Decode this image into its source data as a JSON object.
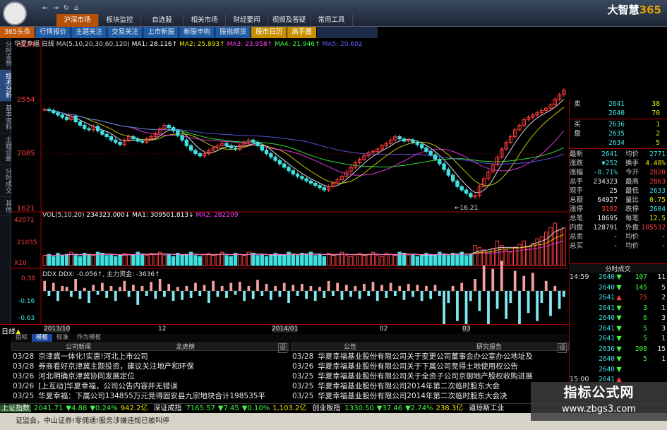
{
  "app": {
    "brand_name": "大智慧",
    "brand_num": "365",
    "top_nav": [
      "←",
      "→",
      "↻",
      "⌂"
    ],
    "menu": [
      "沪深市场",
      "板块监控",
      "自选股",
      "相关市场",
      "财经要闻",
      "视频及答疑",
      "常用工具"
    ],
    "menu_active_index": 0
  },
  "nav2": [
    {
      "label": "365头条",
      "style": "orange"
    },
    {
      "label": "行情报价",
      "style": "blue"
    },
    {
      "label": "主题关注",
      "style": "blue"
    },
    {
      "label": "交易关注",
      "style": "blue"
    },
    {
      "label": "上市新股",
      "style": "blue"
    },
    {
      "label": "新股申购",
      "style": "blue"
    },
    {
      "label": "股指期货",
      "style": "blue"
    },
    {
      "label": "股市日历",
      "style": "gold"
    },
    {
      "label": "高手圈",
      "style": "gold"
    }
  ],
  "left_tabs": [
    {
      "label": "分时走势",
      "active": false
    },
    {
      "label": "技术分析",
      "active": true
    },
    {
      "label": "基本资料",
      "active": false
    },
    {
      "label": "主题诊断",
      "active": false
    },
    {
      "label": "分时成交",
      "active": false
    },
    {
      "label": "其他",
      "active": false
    }
  ],
  "chart_header": {
    "stock_name": "华夏幸福",
    "period": "日线",
    "ma_text": "MA(5,10,20,30,60,120)",
    "ma1": "MA1: 28.116↑",
    "ma2": "MA2: 25.893↑",
    "ma3": "MA3: 23.958↑",
    "ma4": "MA4: 21.946↑",
    "ma5": "MA5: 20.602"
  },
  "price_axis": [
    "3024",
    "2554",
    "2085",
    "1621"
  ],
  "low_marker": "16.21",
  "vol_header": {
    "text": "VOL(5,10,20)",
    "vol": "234323.000↓",
    "ma1": "MA1: 309501.813↓",
    "ma2": "MA2: 282209"
  },
  "vol_axis": [
    "42071",
    "21035",
    "X10"
  ],
  "ddx_header": {
    "text": "DDX  DDX: -0.056↑, 主力资金: -3636↑"
  },
  "ddx_axis": [
    "0.38",
    "-0.16",
    "-0.63"
  ],
  "date_axis": [
    "2013/10",
    "12",
    "2014/01",
    "02",
    "03"
  ],
  "period_label": "日线",
  "subtabs": [
    {
      "label": "指标",
      "active": false
    },
    {
      "label": "模板",
      "active": true
    },
    {
      "label": "标准",
      "active": false
    },
    {
      "label": "作为模板",
      "active": false
    }
  ],
  "colors": {
    "up": "#ff3c3c",
    "down": "#40e0e0",
    "ma1": "#ffffff",
    "ma2": "#e8e800",
    "ma3": "#ff40ff",
    "ma4": "#40ff40",
    "ma5": "#6060ff"
  },
  "order_book": {
    "sell": [
      {
        "label": "卖",
        "price": "2641",
        "qty": "38"
      },
      {
        "label": "",
        "price": "2640",
        "qty": "70"
      }
    ],
    "buy": [
      {
        "label": "买",
        "price": "2636",
        "qty": "1"
      },
      {
        "label": "盘",
        "price": "2635",
        "qty": "2"
      },
      {
        "label": "",
        "price": "2634",
        "qty": "5"
      }
    ]
  },
  "quote": [
    {
      "k1": "最新",
      "v1": "2641",
      "k2": "均价",
      "v2": "2771"
    },
    {
      "k1": "涨跌",
      "v1": "▼252",
      "k2": "换手",
      "v2": "4.48%"
    },
    {
      "k1": "涨幅",
      "v1": "-8.71%",
      "k2": "今开",
      "v2": "2820"
    },
    {
      "k1": "总手",
      "v1": "234323",
      "k2": "最高",
      "v2": "2863"
    },
    {
      "k1": "现手",
      "v1": "25",
      "k2": "最低",
      "v2": "2633"
    },
    {
      "k1": "总额",
      "v1": "64927",
      "k2": "量比",
      "v2": "0.75"
    },
    {
      "k1": "涨停",
      "v1": "3182",
      "k2": "跌停",
      "v2": "2604"
    },
    {
      "k1": "总笔",
      "v1": "18695",
      "k2": "每笔",
      "v2": "12.5"
    },
    {
      "k1": "内盘",
      "v1": "128791",
      "k2": "外盘",
      "v2": "105532"
    },
    {
      "k1": "总卖",
      "v1": "-",
      "k2": "均价",
      "v2": "-"
    },
    {
      "k1": "总买",
      "v1": "-",
      "k2": "均价",
      "v2": "-"
    }
  ],
  "trades_title": "分时成交",
  "trades": [
    {
      "time": "14:59",
      "price": "2640",
      "arrow": "▼",
      "qty": "107",
      "n": "11"
    },
    {
      "time": "",
      "price": "2640",
      "arrow": "▼",
      "qty": "145",
      "n": "5"
    },
    {
      "time": "",
      "price": "2641",
      "arrow": "▲",
      "qty": "75",
      "n": "2"
    },
    {
      "time": "",
      "price": "2641",
      "arrow": "▼",
      "qty": "3",
      "n": "1"
    },
    {
      "time": "",
      "price": "2640",
      "arrow": "▼",
      "qty": "6",
      "n": "3"
    },
    {
      "time": "",
      "price": "2641",
      "arrow": "▼",
      "qty": "5",
      "n": "3"
    },
    {
      "time": "",
      "price": "2641",
      "arrow": "▼",
      "qty": "5",
      "n": "1"
    },
    {
      "time": "",
      "price": "2636",
      "arrow": "▼",
      "qty": "208",
      "n": "15"
    },
    {
      "time": "",
      "price": "2640",
      "arrow": "▼",
      "qty": "5",
      "n": "1"
    },
    {
      "time": "",
      "price": "2640",
      "arrow": "▼",
      "qty": "",
      "n": ""
    },
    {
      "time": "15:00",
      "price": "2641",
      "arrow": "▲",
      "qty": "",
      "n": ""
    }
  ],
  "news_left": {
    "title1": "公司新闻",
    "title2": "龙虎榜",
    "items": [
      {
        "date": "03/28",
        "text": "京津冀一体化!实惠!河北上市公司"
      },
      {
        "date": "03/28",
        "text": "券商看好京津冀主题投资，建议关注地产和环保"
      },
      {
        "date": "03/26",
        "text": "河北明确京津冀协同发展定位"
      },
      {
        "date": "03/26",
        "text": "[上互动]华夏幸福，公司公告内容并无错误"
      },
      {
        "date": "03/25",
        "text": "华夏幸福：下属公司134855万元竞得固安县九宗地块合计198535平"
      }
    ]
  },
  "news_right": {
    "title1": "公告",
    "title2": "研究报告",
    "items": [
      {
        "date": "03/28",
        "text": "华夏幸福基业股份有限公司关于变更公司董事会办公室办公地址及"
      },
      {
        "date": "03/26",
        "text": "华夏幸福基业股份有限公司关于下属公司竞得土地使用权公告"
      },
      {
        "date": "03/25",
        "text": "华夏幸福基业股份有限公司关于全资子公司京御地产股权收购进展"
      },
      {
        "date": "03/25",
        "text": "华夏幸福基业股份有限公司2014年第二次临时股东大会"
      },
      {
        "date": "03/25",
        "text": "华夏幸福基业股份有限公司2014年第二次临时股东大会决"
      }
    ]
  },
  "settings_label": "设",
  "ticker": [
    {
      "name": "上证指数",
      "price": "2041.71",
      "chg": "▼4.88",
      "pct": "▼0.24%",
      "amt": "942.2亿"
    },
    {
      "name": "深证成指",
      "price": "7165.57",
      "chg": "▼7.45",
      "pct": "▼0.10%",
      "amt": "1,103.2亿"
    },
    {
      "name": "创业板指",
      "price": "1330.50",
      "chg": "▼37.46",
      "pct": "▼2.74%",
      "amt": "238.3亿"
    },
    {
      "name": "道琼斯工业",
      "price": "",
      "chg": "",
      "pct": "",
      "amt": ""
    }
  ],
  "status_text": "证监会，中山证券!零佣通!服务涉嫌违规已被叫停",
  "watermark": {
    "line1": "指标公式网",
    "line2": "www.zbgs3.com"
  },
  "chart_data": {
    "type": "candlestick",
    "x_axis_labels": [
      "2013/10",
      "12",
      "2014/01",
      "02",
      "03"
    ],
    "price_ticks": [
      "3024",
      "2554",
      "2085",
      "1621"
    ],
    "ylim": [
      1580,
      3060
    ],
    "close": [
      2470,
      2460,
      2440,
      2420,
      2400,
      2380,
      2410,
      2360,
      2330,
      2300,
      2290,
      2320,
      2280,
      2250,
      2230,
      2200,
      2180,
      2160,
      2200,
      2230,
      2210,
      2190,
      2180,
      2210,
      2230,
      2260,
      2300,
      2330,
      2310,
      2280,
      2240,
      2200,
      2150,
      2110,
      2080,
      2060,
      2080,
      2110,
      2130,
      2150,
      2170,
      2150,
      2130,
      2120,
      2150,
      2180,
      2200,
      2180,
      2150,
      2110,
      2080,
      2050,
      2020,
      1990,
      1960,
      1930,
      1900,
      1880,
      1860,
      1840,
      1820,
      1800,
      1780,
      1760,
      1790,
      1820,
      1850,
      1880,
      1920,
      1960,
      2000,
      2030,
      2060,
      2090,
      2100,
      2120,
      2150,
      2170,
      2200,
      2230,
      2210,
      2190,
      2200,
      2180,
      2160,
      2130,
      2100,
      2070,
      2030,
      1990,
      1940,
      1890,
      1840,
      1790,
      1760,
      1730,
      1700,
      1710,
      1790,
      1860,
      1920,
      1980,
      2050,
      2120,
      2180,
      2230,
      2290,
      2330,
      2380,
      2400,
      2420,
      2440,
      2460,
      2480,
      2510,
      2560,
      2600,
      2640
    ],
    "ma_note": "MA5/10/20/30/60/120"
  },
  "vol_data": {
    "values": [
      9,
      10,
      8,
      11,
      9,
      10,
      12,
      9,
      8,
      11,
      10,
      9,
      12,
      11,
      9,
      10,
      8,
      9,
      11,
      10,
      9,
      12,
      10,
      9,
      11,
      10,
      12,
      9,
      10,
      8,
      11,
      9,
      10,
      12,
      9,
      8,
      10,
      11,
      9,
      10,
      12,
      9,
      8,
      11,
      10,
      9,
      12,
      11,
      9,
      10,
      8,
      9,
      11,
      10,
      9,
      12,
      10,
      9,
      11,
      10,
      12,
      9,
      10,
      8,
      11,
      9,
      10,
      12,
      9,
      8,
      10,
      11,
      9,
      10,
      12,
      9,
      8,
      11,
      10,
      9,
      12,
      11,
      9,
      10,
      8,
      9,
      11,
      10,
      9,
      12,
      10,
      9,
      11,
      10,
      12,
      9,
      10,
      18,
      16,
      14,
      12,
      15,
      22,
      18,
      14,
      12,
      16,
      19,
      22,
      17,
      20,
      24,
      26,
      30,
      34,
      38,
      32,
      34
    ]
  },
  "ddx_data": {
    "values": [
      0.1,
      -0.05,
      0.08,
      -0.1,
      0.05,
      0.04,
      -0.06,
      0.12,
      -0.08,
      0.03,
      -0.12,
      0.06,
      -0.04,
      0.08,
      -0.07,
      0.05,
      -0.1,
      0.04,
      0.1,
      -0.06,
      0.06,
      -0.14,
      0.05,
      -0.05,
      0.09,
      -0.08,
      0.12,
      -0.06,
      0.07,
      -0.1,
      0.04,
      -0.09,
      0.05,
      -0.07,
      0.08,
      -0.05,
      0.06,
      -0.12,
      0.1,
      -0.06,
      0.05,
      -0.07,
      0.08,
      -0.04,
      0.09,
      -0.1,
      0.05,
      -0.08,
      0.11,
      -0.05,
      0.07,
      -0.09,
      0.05,
      -0.06,
      0.08,
      -0.12,
      0.06,
      -0.05,
      0.07,
      -0.08,
      0.05,
      -0.1,
      0.04,
      -0.07,
      0.1,
      -0.05,
      0.08,
      -0.09,
      0.06,
      -0.06,
      0.05,
      -0.08,
      0.07,
      -0.05,
      0.09,
      -0.1,
      0.06,
      -0.07,
      0.08,
      -0.05,
      0.05,
      -0.09,
      0.07,
      -0.06,
      0.06,
      -0.1,
      0.05,
      -0.08,
      0.06,
      -0.05,
      -0.4,
      -0.12,
      0.05,
      -0.3,
      0.08,
      -0.45,
      -0.1,
      0.12,
      -0.2,
      0.25,
      -0.35,
      0.22,
      -0.18,
      0.3,
      -0.28,
      -0.12,
      0.2,
      -0.35,
      0.15,
      -0.22,
      0.18,
      -0.3,
      -0.12,
      0.1,
      -0.25,
      0.05,
      -0.18,
      -0.06
    ]
  }
}
